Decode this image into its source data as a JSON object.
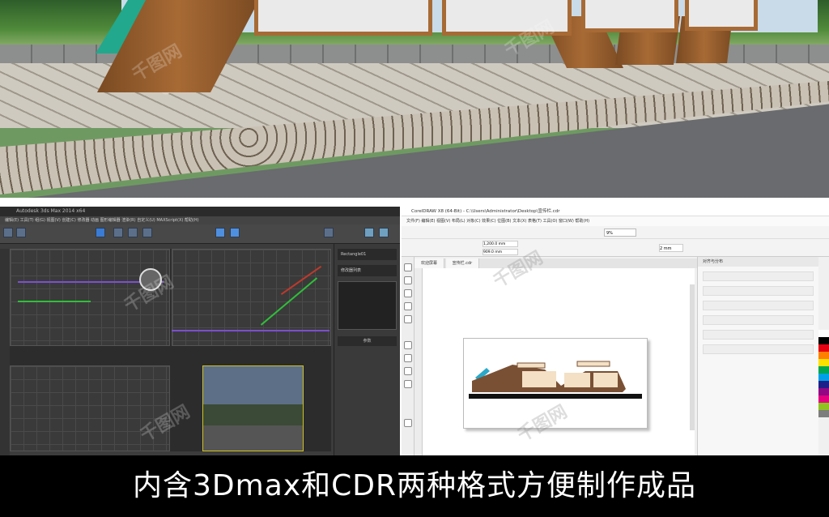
{
  "caption": "内含3Dmax和CDR两种格式方便制作成品",
  "watermark": "千图网",
  "max_window": {
    "title": "Autodesk 3ds Max 2014 x64",
    "menu": "编辑(E)  工具(T)  组(G)  视图(V)  创建(C)  修改器  动画  图形编辑器  渲染(R)  自定义(U)  MAXScript(X)  帮助(H)",
    "command_panel": {
      "header": "Rectangle01",
      "modifier": "修改器列表",
      "rollout": "参数"
    }
  },
  "cdr_window": {
    "title": "CorelDRAW X8 (64-Bit) - C:\\Users\\Administrator\\Desktop\\宣传栏.cdr",
    "menu": "文件(F)  编辑(E)  视图(V)  布局(L)  对象(C)  效果(C)  位图(B)  文本(X)  表格(T)  工具(O)  窗口(W)  帮助(H)",
    "tabs": [
      "欢迎屏幕",
      "宣传栏.cdr"
    ],
    "zoom": "9%",
    "docker_title": "对齐与分布",
    "nudge": "2 mm",
    "size_w": "1,200.0 mm",
    "size_h": "909.0 mm"
  }
}
